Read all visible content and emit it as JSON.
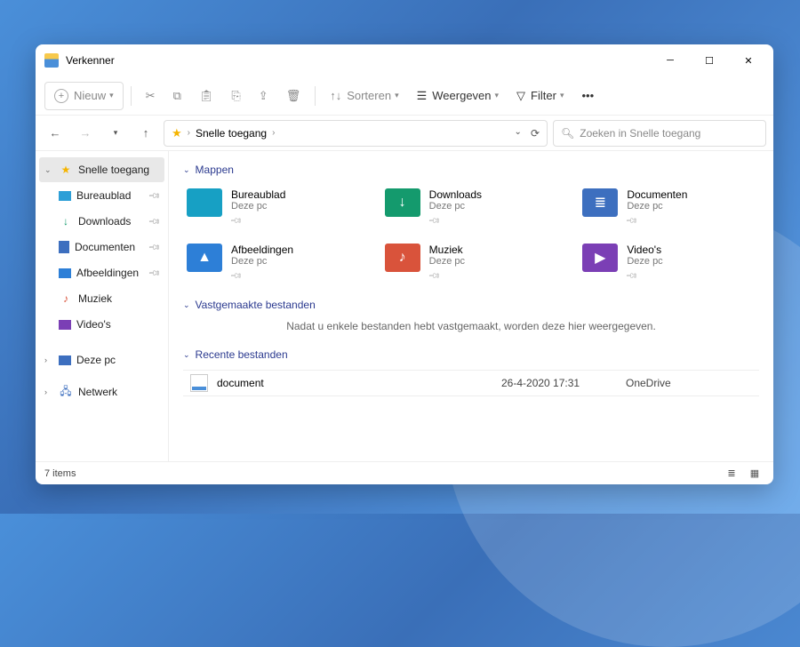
{
  "window": {
    "title": "Verkenner"
  },
  "toolbar": {
    "new": "Nieuw",
    "sort": "Sorteren",
    "view": "Weergeven",
    "filter": "Filter"
  },
  "breadcrumb": {
    "current": "Snelle toegang"
  },
  "search": {
    "placeholder": "Zoeken in Snelle toegang"
  },
  "sidebar": {
    "quick": "Snelle toegang",
    "items": [
      {
        "label": "Bureaublad"
      },
      {
        "label": "Downloads"
      },
      {
        "label": "Documenten"
      },
      {
        "label": "Afbeeldingen"
      },
      {
        "label": "Muziek"
      },
      {
        "label": "Video's"
      }
    ],
    "thispc": "Deze pc",
    "network": "Netwerk"
  },
  "sections": {
    "folders": "Mappen",
    "pinned": "Vastgemaakte bestanden",
    "recent": "Recente bestanden"
  },
  "folders": [
    {
      "name": "Bureaublad",
      "sub": "Deze pc",
      "color": "#17a0c4",
      "glyph": ""
    },
    {
      "name": "Downloads",
      "sub": "Deze pc",
      "color": "#149a6d",
      "glyph": "↓"
    },
    {
      "name": "Documenten",
      "sub": "Deze pc",
      "color": "#3d6fbf",
      "glyph": "≣"
    },
    {
      "name": "Afbeeldingen",
      "sub": "Deze pc",
      "color": "#2d7fd7",
      "glyph": "▲"
    },
    {
      "name": "Muziek",
      "sub": "Deze pc",
      "color": "#d9533b",
      "glyph": "♪"
    },
    {
      "name": "Video's",
      "sub": "Deze pc",
      "color": "#7b3fb5",
      "glyph": "▶"
    }
  ],
  "pinned_empty": "Nadat u enkele bestanden hebt vastgemaakt, worden deze hier weergegeven.",
  "recent": [
    {
      "name": "document",
      "date": "26-4-2020 17:31",
      "location": "OneDrive"
    }
  ],
  "status": {
    "count": "7 items"
  }
}
